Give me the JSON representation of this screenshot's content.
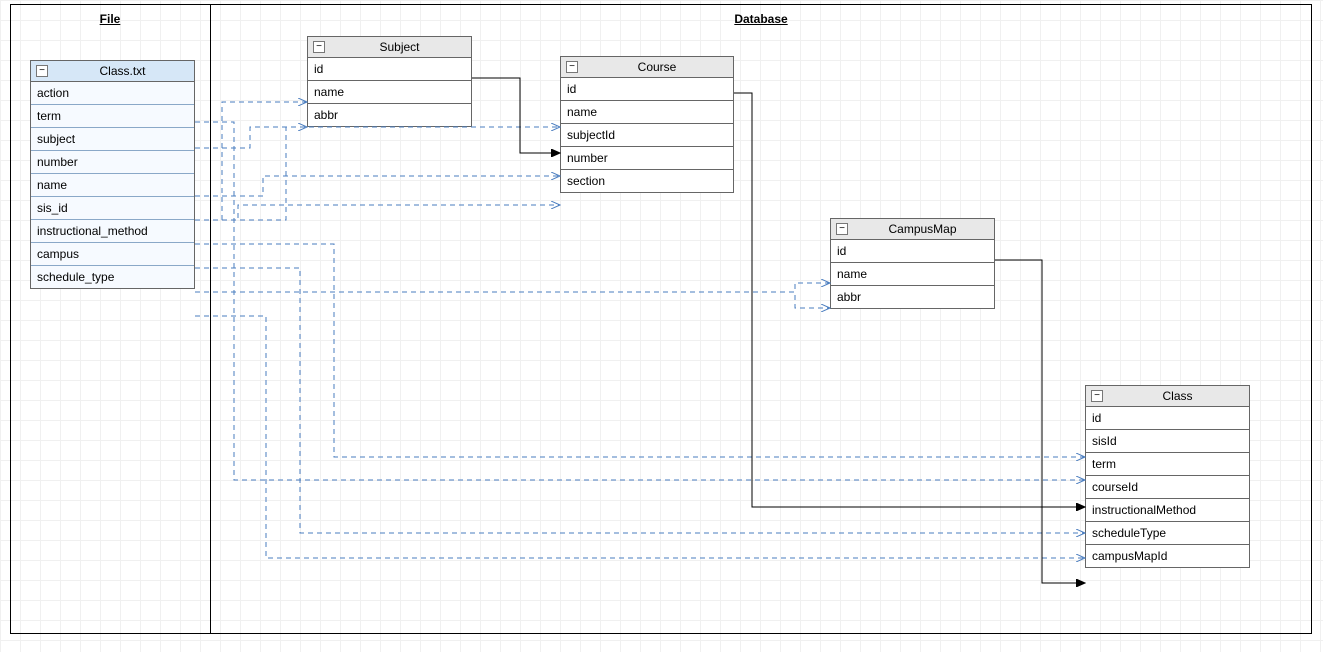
{
  "sections": {
    "file": "File",
    "database": "Database"
  },
  "entities": {
    "classtxt": {
      "title": "Class.txt",
      "fields": [
        "action",
        "term",
        "subject",
        "number",
        "name",
        "sis_id",
        "instructional_method",
        "campus",
        "schedule_type"
      ]
    },
    "subject": {
      "title": "Subject",
      "fields": [
        "id",
        "name",
        "abbr"
      ]
    },
    "course": {
      "title": "Course",
      "fields": [
        "id",
        "name",
        "subjectId",
        "number",
        "section"
      ]
    },
    "campusmap": {
      "title": "CampusMap",
      "fields": [
        "id",
        "name",
        "abbr"
      ]
    },
    "class": {
      "title": "Class",
      "fields": [
        "id",
        "sisId",
        "term",
        "courseId",
        "instructionalMethod",
        "scheduleType",
        "campusMapId"
      ]
    }
  },
  "glyph": {
    "minus": "−"
  }
}
